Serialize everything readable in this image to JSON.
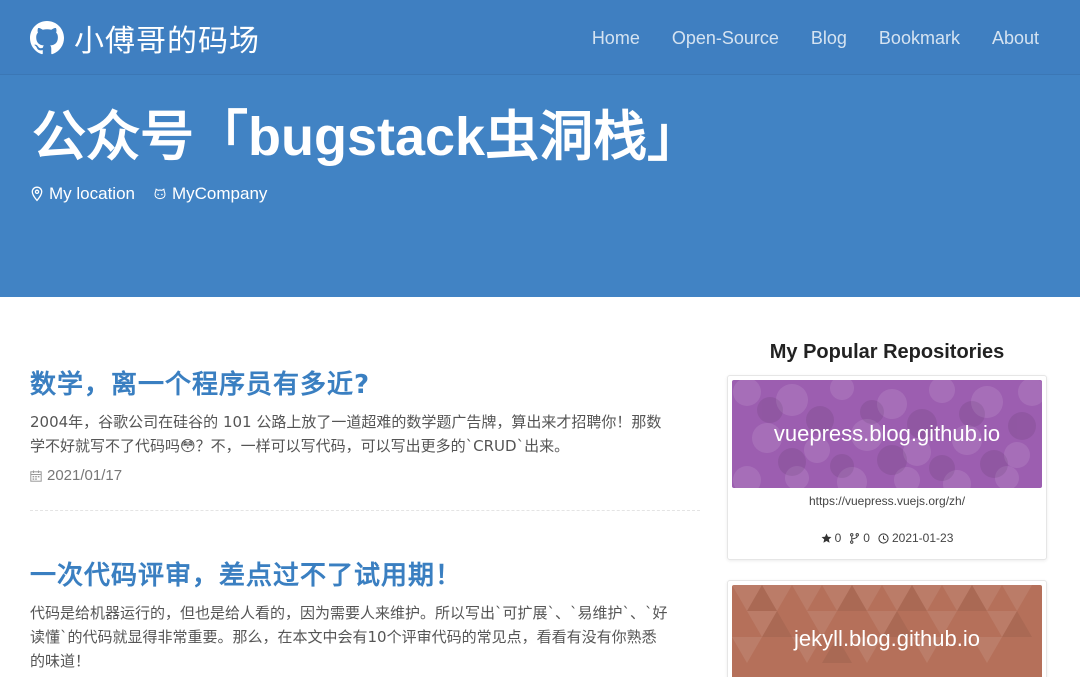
{
  "header": {
    "brand": "小傅哥的码场",
    "nav": [
      "Home",
      "Open-Source",
      "Blog",
      "Bookmark",
      "About"
    ],
    "title": "公众号「bugstack虫洞栈」",
    "location": "My location",
    "company": "MyCompany"
  },
  "posts": [
    {
      "title": "数学，离一个程序员有多近?",
      "excerpt_line1": "2004年，谷歌公司在硅谷的 101 公路上放了一道超难的数学题广告牌，算出来才招聘你！那数",
      "excerpt_line2": "学不好就写不了代码吗😳？不，一样可以写代码，可以写出更多的`CRUD`出来。",
      "date": "2021/01/17"
    },
    {
      "title": "一次代码评审，差点过不了试用期！",
      "excerpt_line1": "代码是给机器运行的，但也是给人看的，因为需要人来维护。所以写出`可扩展`、`易维护`、`好",
      "excerpt_line2": "读懂`的代码就显得非常重要。那么，在本文中会有10个评审代码的常见点，看看有没有你熟悉",
      "excerpt_line3": "的味道！"
    }
  ],
  "sidebar": {
    "heading": "My Popular Repositories",
    "repos": [
      {
        "name": "vuepress.blog.github.io",
        "url": "https://vuepress.vuejs.org/zh/",
        "stars": "0",
        "forks": "0",
        "updated": "2021-01-23",
        "color": "#9c5eb0"
      },
      {
        "name": "jekyll.blog.github.io",
        "color": "#b5705a"
      }
    ]
  },
  "colors": {
    "header": "#4183c4",
    "link": "#3a7fc1"
  }
}
